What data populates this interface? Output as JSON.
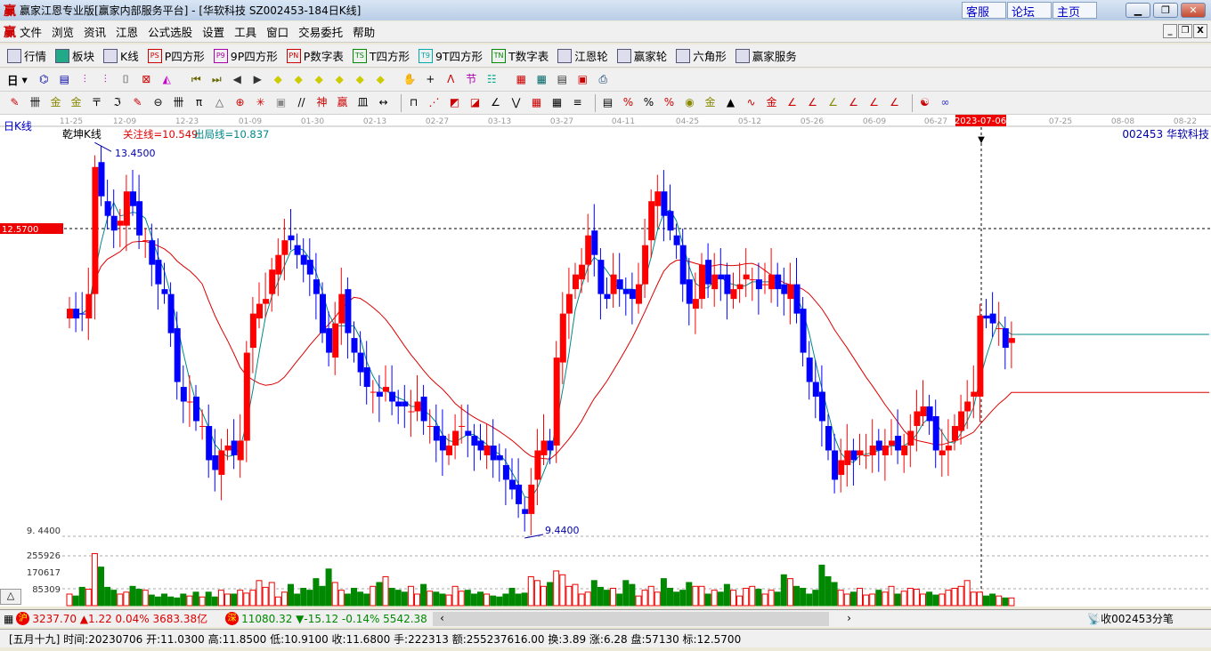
{
  "window": {
    "title": "赢家江恩专业版[赢家内部服务平台] - [华软科技   SZ002453-184日K线]",
    "logo": "赢",
    "links": [
      "客服",
      "论坛",
      "主页"
    ]
  },
  "menu": [
    "文件",
    "浏览",
    "资讯",
    "江恩",
    "公式选股",
    "设置",
    "工具",
    "窗口",
    "交易委托",
    "帮助"
  ],
  "toolbar1": [
    {
      "icon": "quote-table-icon",
      "label": "行情"
    },
    {
      "icon": "sector-icon",
      "label": "板块"
    },
    {
      "icon": "kline-icon",
      "label": "K线"
    },
    {
      "icon": "PS",
      "label": "P四方形"
    },
    {
      "icon": "P9",
      "label": "9P四方形"
    },
    {
      "icon": "PN",
      "label": "P数字表"
    },
    {
      "icon": "TS",
      "label": "T四方形"
    },
    {
      "icon": "T9",
      "label": "9T四方形"
    },
    {
      "icon": "TN",
      "label": "T数字表"
    },
    {
      "icon": "gann-wheel-icon",
      "label": "江恩轮"
    },
    {
      "icon": "winner-wheel-icon",
      "label": "赢家轮"
    },
    {
      "icon": "hexagon-icon",
      "label": "六角形"
    },
    {
      "icon": "dollar-icon",
      "label": "赢家服务"
    }
  ],
  "toolbar2": {
    "period": "日"
  },
  "chart": {
    "period_label": "日K线",
    "indicator_name": "乾坤K线",
    "focus_line": "关注线=10.549",
    "exit_line": "出局线=10.837",
    "stock": "002453  华软科技",
    "high_label": "13.4500",
    "low_label": "9.4400",
    "crosshair_price": "12.5700",
    "crosshair_date": "2023-07-06",
    "price_axis_label": "9. 4400",
    "volume_ticks": [
      "255926",
      "170617",
      "85309"
    ],
    "dates": [
      "11-25",
      "12-09",
      "12-23",
      "01-09",
      "01-30",
      "02-13",
      "02-27",
      "03-13",
      "03-27",
      "04-11",
      "04-25",
      "05-12",
      "05-26",
      "06-09",
      "06-27",
      "07-25",
      "08-08",
      "08-22"
    ]
  },
  "chart_data": {
    "type": "candlestick",
    "price_range": [
      9.44,
      13.45
    ],
    "closes": [
      11.75,
      11.65,
      11.7,
      11.9,
      13.2,
      12.9,
      12.7,
      12.55,
      12.65,
      12.95,
      12.8,
      12.5,
      12.45,
      12.2,
      12.0,
      11.9,
      11.5,
      11.0,
      10.8,
      10.8,
      10.6,
      10.55,
      10.2,
      10.1,
      10.3,
      10.35,
      10.25,
      10.4,
      11.3,
      11.7,
      11.8,
      11.85,
      12.15,
      12.3,
      12.45,
      12.45,
      12.3,
      12.2,
      12.1,
      11.9,
      11.5,
      11.3,
      11.6,
      11.9,
      11.5,
      11.3,
      11.1,
      10.95,
      10.9,
      10.85,
      10.95,
      10.8,
      10.75,
      10.75,
      10.7,
      10.8,
      10.6,
      10.55,
      10.4,
      10.3,
      10.35,
      10.5,
      10.55,
      10.45,
      10.35,
      10.3,
      10.35,
      10.2,
      10.2,
      10.0,
      9.9,
      9.75,
      9.65,
      9.95,
      10.3,
      10.4,
      10.3,
      11.25,
      11.7,
      11.9,
      12.1,
      12.2,
      12.5,
      12.3,
      11.9,
      11.85,
      12.1,
      11.95,
      11.9,
      11.85,
      12.0,
      12.4,
      12.85,
      12.95,
      12.7,
      12.55,
      12.4,
      12.0,
      11.8,
      11.85,
      12.2,
      12.0,
      12.1,
      12.05,
      11.9,
      11.95,
      12.0,
      12.1,
      12.05,
      11.95,
      12.0,
      12.1,
      11.95,
      11.9,
      12.0,
      11.7,
      11.3,
      11.0,
      10.85,
      10.6,
      10.3,
      10.0,
      10.2,
      10.3,
      10.2,
      10.3,
      10.25,
      10.35,
      10.3,
      10.35,
      10.4,
      10.3,
      10.35,
      10.5,
      10.7,
      10.75,
      10.6,
      10.3,
      10.3,
      10.35,
      10.55,
      10.7,
      10.8,
      10.9,
      11.68,
      11.65,
      11.6,
      11.55,
      11.35,
      11.45
    ],
    "volumes_k": [
      60,
      50,
      95,
      85,
      270,
      200,
      95,
      80,
      60,
      70,
      100,
      85,
      80,
      55,
      45,
      60,
      45,
      40,
      60,
      50,
      70,
      45,
      70,
      45,
      80,
      60,
      60,
      80,
      65,
      80,
      130,
      95,
      120,
      45,
      70,
      110,
      60,
      90,
      80,
      140,
      100,
      190,
      120,
      80,
      60,
      90,
      70,
      60,
      100,
      120,
      150,
      90,
      80,
      70,
      100,
      60,
      110,
      75,
      70,
      60,
      55,
      100,
      75,
      80,
      60,
      70,
      60,
      50,
      45,
      60,
      90,
      60,
      65,
      150,
      130,
      100,
      120,
      180,
      160,
      100,
      110,
      60,
      70,
      130,
      95,
      80,
      90,
      60,
      130,
      110,
      50,
      80,
      100,
      70,
      140,
      90,
      70,
      80,
      120,
      100,
      100,
      60,
      80,
      70,
      110,
      80,
      50,
      90,
      100,
      85,
      60,
      80,
      70,
      160,
      140,
      100,
      90,
      60,
      80,
      210,
      150,
      120,
      80,
      60,
      70,
      90,
      55,
      60,
      80,
      70,
      100,
      60,
      75,
      90,
      85,
      60,
      70,
      55,
      60,
      80,
      90,
      100,
      130,
      70,
      70,
      50,
      60,
      50,
      40,
      40
    ]
  },
  "index_bar": {
    "sh_badge": "沪",
    "sh": "3237.70 ▲1.22 0.04% 3683.38亿",
    "sz_badge": "深",
    "sz": "11080.32 ▼-15.12 -0.14% 5542.38",
    "receive": "收002453分笔"
  },
  "status": "[五月十九] 时间:20230706 开:11.0300 高:11.8500 低:10.9100 收:11.6800 手:222313 额:255237616.00 换:3.89 涨:6.28 盘:57130 标:12.5700"
}
